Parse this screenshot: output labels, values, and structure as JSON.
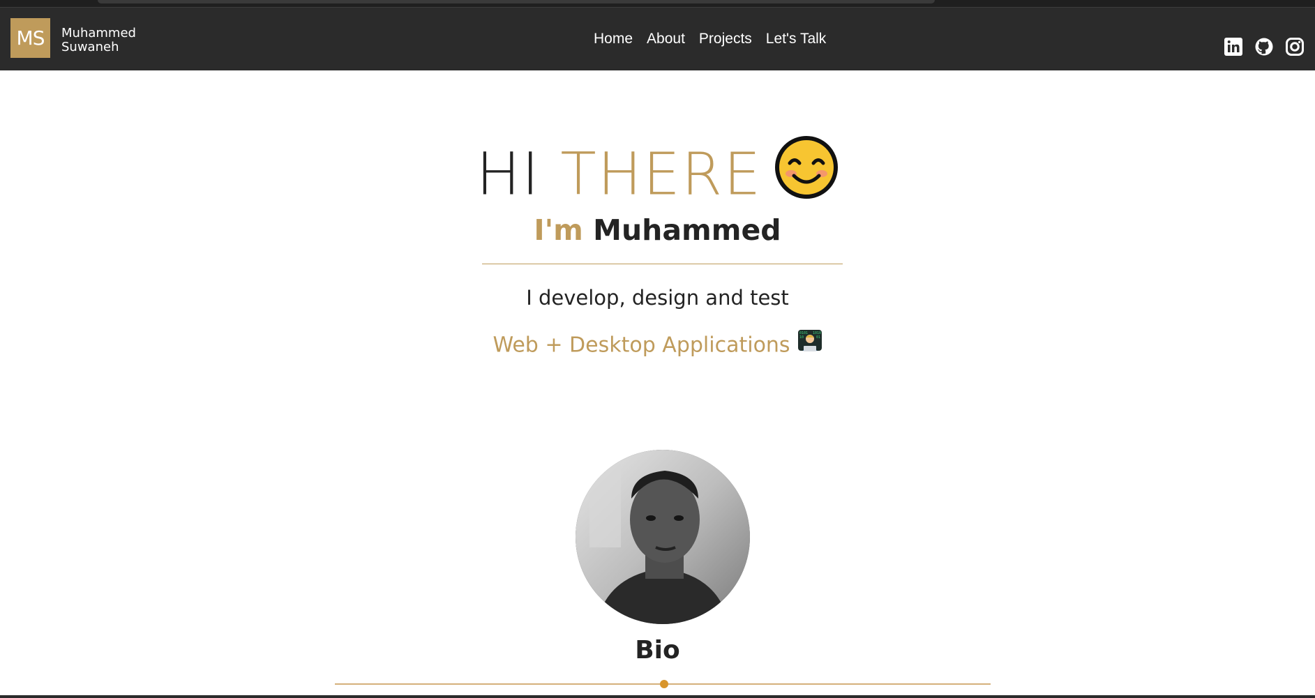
{
  "header": {
    "logo_text": "MS",
    "brand_line1": "Muhammed",
    "brand_line2": "Suwaneh",
    "nav": [
      {
        "label": "Home"
      },
      {
        "label": "About"
      },
      {
        "label": "Projects"
      },
      {
        "label": "Let's Talk"
      }
    ],
    "socials": [
      "linkedin-icon",
      "github-icon",
      "instagram-icon"
    ]
  },
  "hero": {
    "greeting_part1": "HI",
    "greeting_part2": "THERE",
    "greeting_emoji": "smiling-face-icon",
    "intro_prefix": "I'm",
    "intro_name": "Muhammed",
    "tagline": "I develop, design and test",
    "tagline2": "Web + Desktop Applications",
    "tagline2_emoji": "technologist-icon"
  },
  "bio": {
    "heading": "Bio"
  },
  "colors": {
    "accent": "#bf9b5b",
    "navbar_bg": "#2b2b2b",
    "text_dark": "#232323",
    "timeline_dot": "#d8952b"
  }
}
